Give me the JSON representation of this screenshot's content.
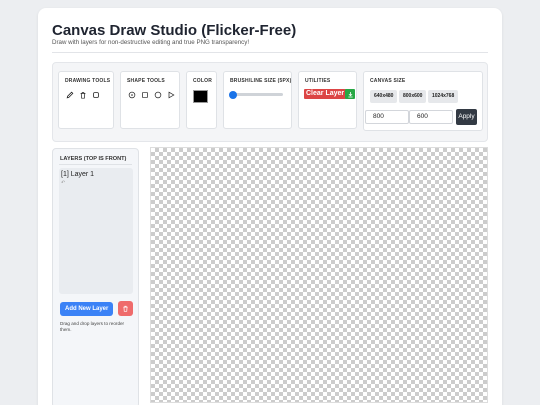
{
  "header": {
    "title": "Canvas Draw Studio (Flicker-Free)",
    "subtitle": "Draw with layers for non-destructive editing and true PNG transparency!"
  },
  "toolbar": {
    "drawing_tools": {
      "label": "DRAWING TOOLS",
      "tools": [
        "pencil-icon",
        "trash-icon",
        "eraser-icon"
      ]
    },
    "shape_tools": {
      "label": "SHAPE TOOLS",
      "tools": [
        "target-icon",
        "square-icon",
        "circle-icon",
        "triangle-icon"
      ]
    },
    "color": {
      "label": "COLOR",
      "value": "#000000"
    },
    "brush_size": {
      "label": "BRUSH/LINE SIZE (5PX)",
      "value_fraction": 0.05
    },
    "utilities": {
      "label": "UTILITIES",
      "clear_label": "Clear Layer",
      "download_icon": "download-icon",
      "clear_color": "#dc4545",
      "download_color": "#27a844"
    },
    "canvas_size": {
      "label": "CANVAS SIZE",
      "presets": [
        "640x480",
        "800x600",
        "1024x768"
      ],
      "width": "800",
      "height": "600",
      "apply_label": "Apply"
    }
  },
  "layers": {
    "title": "LAYERS (TOP IS FRONT)",
    "items": [
      {
        "label": "[1] Layer 1",
        "sub": "↶"
      }
    ],
    "add_label": "Add New Layer",
    "hint": "Drag and drop layers to reorder them.",
    "add_color": "#3b82f6",
    "delete_color": "#ef6b6b"
  }
}
